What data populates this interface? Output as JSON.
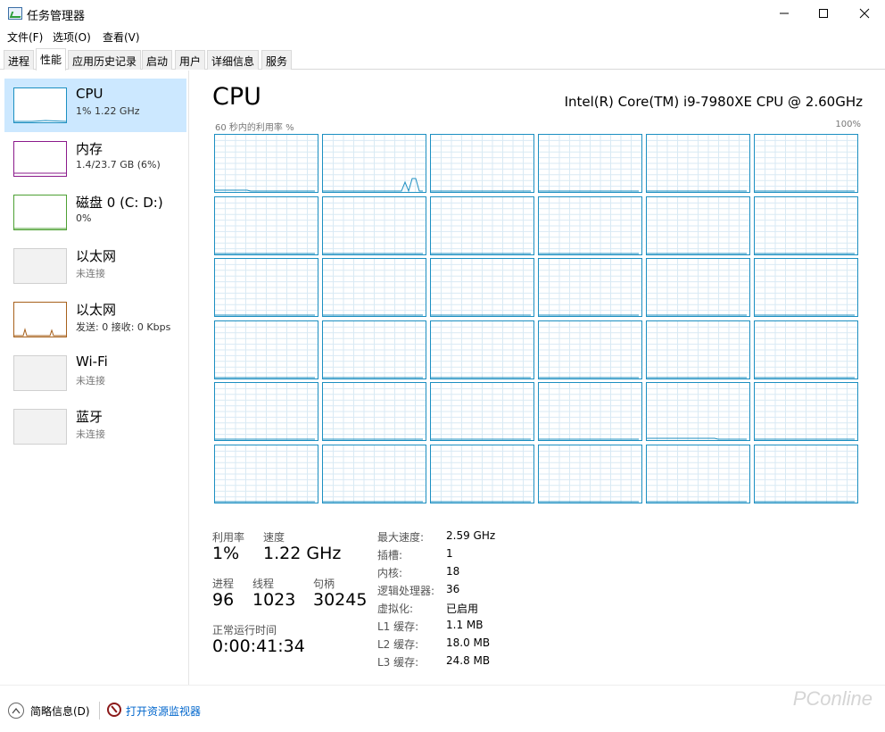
{
  "window": {
    "title": "任务管理器",
    "minimize_glyph": "minimize-icon",
    "maximize_glyph": "maximize-icon",
    "close_glyph": "close-icon"
  },
  "menu": [
    "文件(F)",
    "选项(O)",
    "查看(V)"
  ],
  "tabs": [
    {
      "label": "进程",
      "active": false
    },
    {
      "label": "性能",
      "active": true
    },
    {
      "label": "应用历史记录",
      "active": false
    },
    {
      "label": "启动",
      "active": false
    },
    {
      "label": "用户",
      "active": false
    },
    {
      "label": "详细信息",
      "active": false
    },
    {
      "label": "服务",
      "active": false
    }
  ],
  "sidebar": {
    "items": [
      {
        "name": "CPU",
        "sub": "1% 1.22 GHz",
        "color": "#1c8fc1",
        "selected": true
      },
      {
        "name": "内存",
        "sub": "1.4/23.7 GB (6%)",
        "color": "#8b1a8b",
        "selected": false
      },
      {
        "name": "磁盘 0 (C: D:)",
        "sub": "0%",
        "color": "#4da033",
        "selected": false
      },
      {
        "name": "以太网",
        "sub": "未连接",
        "color": "#a0a0a0",
        "selected": false
      },
      {
        "name": "以太网",
        "sub": "发送: 0 接收: 0 Kbps",
        "color": "#a7601b",
        "selected": false
      },
      {
        "name": "Wi-Fi",
        "sub": "未连接",
        "color": "#a0a0a0",
        "selected": false
      },
      {
        "name": "蓝牙",
        "sub": "未连接",
        "color": "#a0a0a0",
        "selected": false
      }
    ]
  },
  "cpu": {
    "title": "CPU",
    "model": "Intel(R) Core(TM) i9-7980XE CPU @ 2.60GHz",
    "graph_label": "60 秒内的利用率 %",
    "graph_max": "100%",
    "line_color": "#1c8fc1",
    "grid_color": "#d9eaf4",
    "core_count": 36
  },
  "stats": {
    "utilization_label": "利用率",
    "utilization": "1%",
    "speed_label": "速度",
    "speed": "1.22 GHz",
    "processes_label": "进程",
    "processes": "96",
    "threads_label": "线程",
    "threads": "1023",
    "handles_label": "句柄",
    "handles": "30245",
    "uptime_label": "正常运行时间",
    "uptime": "0:00:41:34"
  },
  "specs": [
    {
      "label": "最大速度:",
      "value": "2.59 GHz"
    },
    {
      "label": "插槽:",
      "value": "1"
    },
    {
      "label": "内核:",
      "value": "18"
    },
    {
      "label": "逻辑处理器:",
      "value": "36"
    },
    {
      "label": "虚拟化:",
      "value": "已启用"
    },
    {
      "label": "L1 缓存:",
      "value": "1.1 MB"
    },
    {
      "label": "L2 缓存:",
      "value": "18.0 MB"
    },
    {
      "label": "L3 缓存:",
      "value": "24.8 MB"
    }
  ],
  "footer": {
    "summary_label": "简略信息(D)",
    "monitor_link": "打开资源监视器",
    "watermark": "PConline"
  }
}
